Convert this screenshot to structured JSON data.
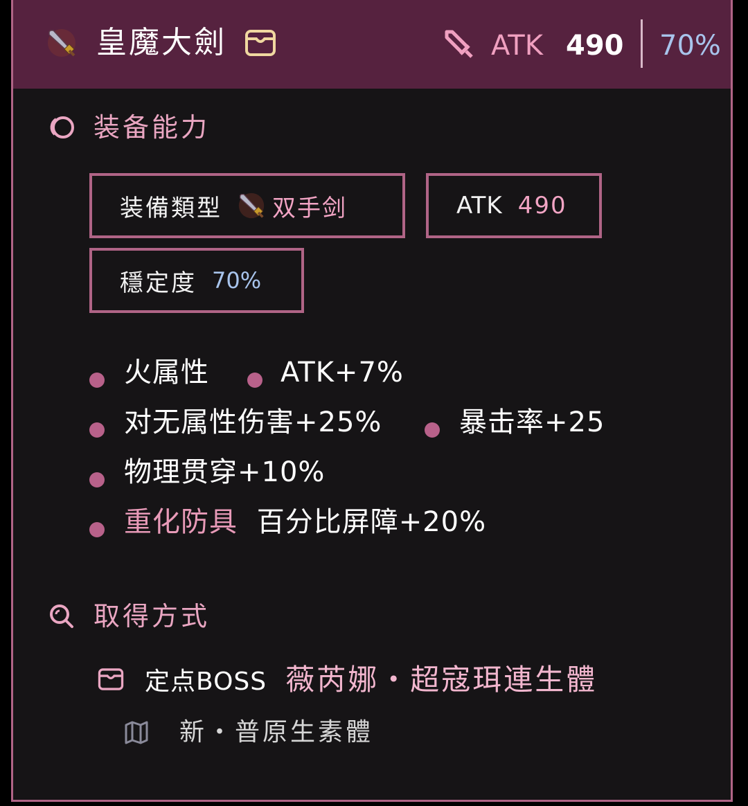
{
  "header": {
    "weapon_icon": "sword-sprite-icon",
    "title": "皇魔大劍",
    "title_badge_icon": "chest-icon",
    "atk_icon": "sword-outline-icon",
    "atk_label": "ATK",
    "atk_value": "490",
    "stability": "70%"
  },
  "abilities": {
    "section_icon": "swirl-icon",
    "title": "装备能力",
    "equip_type": {
      "label": "装備類型",
      "icon": "sword-sprite-icon",
      "value": "双手剑"
    },
    "atk": {
      "label": "ATK",
      "value": "490"
    },
    "stability": {
      "label": "穩定度",
      "value": "70%"
    },
    "traits": [
      "火属性",
      "ATK+7%",
      "对无属性伤害+25%",
      "暴击率+25",
      "物理贯穿+10%",
      "重化防具",
      "百分比屏障+20%"
    ]
  },
  "acquisition": {
    "section_icon": "search-icon",
    "title": "取得方式",
    "source_icon": "chest-icon",
    "source_type": "定点BOSS",
    "boss_name": "薇芮娜・超寇珥連生體",
    "location_icon": "map-icon",
    "location": "新・普原生素體"
  },
  "colors": {
    "header_bg": "#56223f",
    "panel_bg": "#161416",
    "accent": "#b06486",
    "pink_text": "#eaa6c2",
    "blue_text": "#a8c4ec"
  }
}
